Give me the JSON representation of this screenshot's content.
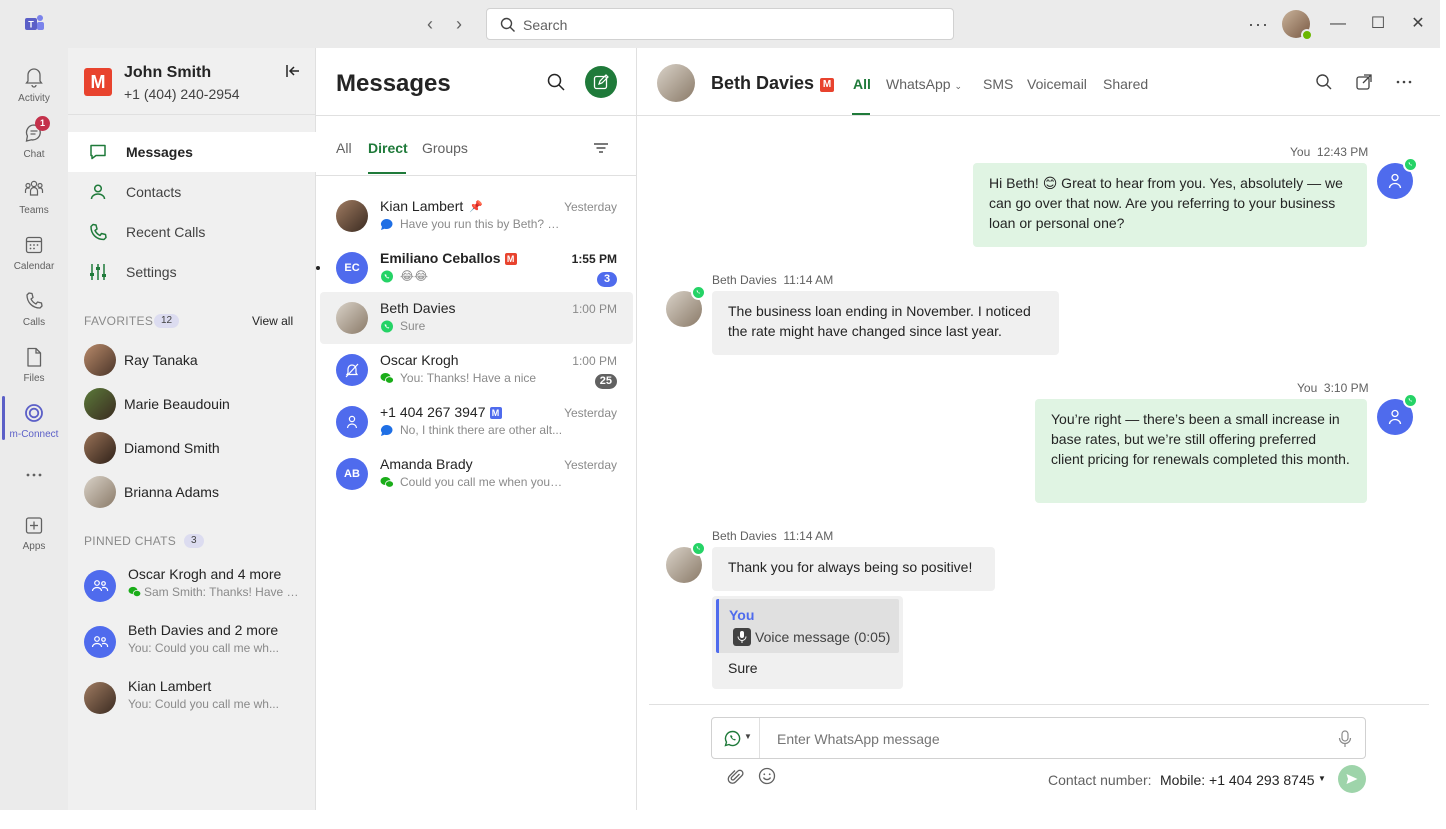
{
  "titlebar": {
    "search_placeholder": "Search",
    "more": "···",
    "icons": {
      "back": "chevron-left-icon",
      "forward": "chevron-right-icon",
      "search": "search-icon"
    }
  },
  "rail": {
    "items": [
      {
        "label": "Activity",
        "icon": "bell-icon"
      },
      {
        "label": "Chat",
        "icon": "chat-icon",
        "badge": "1"
      },
      {
        "label": "Teams",
        "icon": "teams-icon"
      },
      {
        "label": "Calendar",
        "icon": "calendar-icon"
      },
      {
        "label": "Calls",
        "icon": "phone-icon"
      },
      {
        "label": "Files",
        "icon": "file-icon"
      },
      {
        "label": "m-Connect",
        "icon": "m-connect-icon",
        "active": true
      },
      {
        "label": "",
        "icon": "more-icon"
      },
      {
        "label": "Apps",
        "icon": "add-app-icon"
      }
    ]
  },
  "sidebar": {
    "user_name": "John Smith",
    "user_phone": "+1 (404) 240-2954",
    "logo_letter": "M",
    "nav": [
      {
        "label": "Messages",
        "active": true
      },
      {
        "label": "Contacts"
      },
      {
        "label": "Recent Calls"
      },
      {
        "label": "Settings"
      }
    ],
    "favorites": {
      "heading": "FAVORITES",
      "count": "12",
      "view_all": "View all",
      "items": [
        "Ray Tanaka",
        "Marie Beaudouin",
        "Diamond Smith",
        "Brianna Adams"
      ]
    },
    "pinned": {
      "heading": "PINNED CHATS",
      "count": "3",
      "items": [
        {
          "name": "Oscar Krogh and 4 more",
          "preview": "Sam Smith: Thanks! Have a..."
        },
        {
          "name": "Beth Davies and 2 more",
          "preview": "You: Could you call me wh..."
        },
        {
          "name": "Kian Lambert",
          "preview": "You: Could you call me wh..."
        }
      ]
    }
  },
  "messages": {
    "title": "Messages",
    "tabs": [
      "All",
      "Direct",
      "Groups"
    ],
    "active_tab": "Direct",
    "conversations": [
      {
        "name": "Kian Lambert",
        "time": "Yesterday",
        "preview": "Have you run this by Beth? M...",
        "channel": "chat"
      },
      {
        "name": "Emiliano Ceballos",
        "initials": "EC",
        "time": "1:55 PM",
        "preview": "😂😂",
        "channel": "whatsapp",
        "unread": "3"
      },
      {
        "name": "Beth Davies",
        "time": "1:00 PM",
        "preview": "Sure",
        "channel": "whatsapp"
      },
      {
        "name": "Oscar Krogh",
        "time": "1:00 PM",
        "preview": "You: Thanks! Have a nice",
        "channel": "wechat",
        "count": "25"
      },
      {
        "name": "+1 404 267 3947",
        "time": "Yesterday",
        "preview": "No, I think there are other alt...",
        "channel": "chat"
      },
      {
        "name": "Amanda Brady",
        "initials": "AB",
        "time": "Yesterday",
        "preview": "Could you call me when you'r...",
        "channel": "wechat"
      }
    ]
  },
  "chat": {
    "contact_name": "Beth Davies",
    "tabs": [
      "All",
      "WhatsApp",
      "SMS",
      "Voicemail",
      "Shared"
    ],
    "active_tab": "All",
    "messages": [
      {
        "sender": "You",
        "time": "12:43 PM",
        "text": "Hi Beth! 😊 Great to hear from you. Yes, absolutely — we can go over that now. Are you referring to your business loan or personal one?"
      },
      {
        "sender": "Beth Davies",
        "time": "11:14 AM",
        "text": "The business loan ending in November. I noticed the rate might have changed since last year."
      },
      {
        "sender": "You",
        "time": "3:10 PM",
        "text": "You’re right — there’s been a small increase in base rates, but we’re still offering preferred client pricing for renewals completed this month."
      },
      {
        "sender": "Beth Davies",
        "time": "11:14 AM",
        "text": "Thank you for always being so positive!"
      }
    ],
    "reply": {
      "quoted_sender": "You",
      "quoted_text": "Voice message (0:05)",
      "text": "Sure"
    },
    "composer": {
      "placeholder": "Enter WhatsApp message",
      "contact_number_label": "Contact number:",
      "contact_number_value": "Mobile: +1 404 293 8745"
    }
  },
  "colors": {
    "accent_green": "#1f7a3a",
    "teams_purple": "#5b5fc7",
    "outgoing_bubble": "#e0f4e3",
    "incoming_bubble": "#f0f0f0",
    "whatsapp": "#25d366",
    "badge_blue": "#4f6bed",
    "m_brand": "#e8432e"
  }
}
